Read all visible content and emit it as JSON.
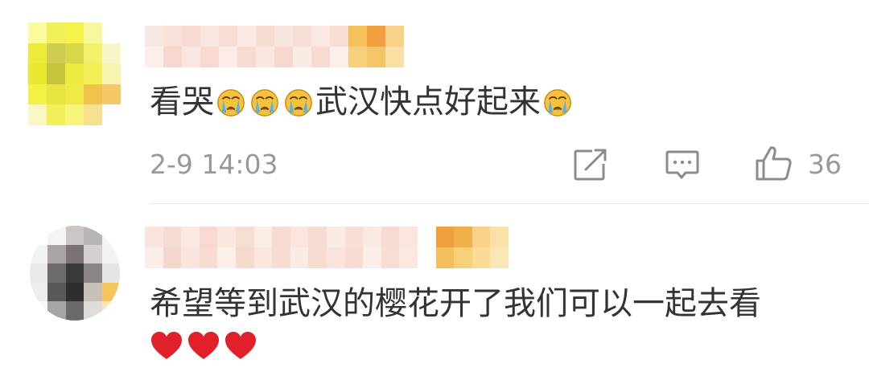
{
  "comments": [
    {
      "text_parts": [
        "看哭",
        "武汉快点好起来"
      ],
      "emoji": "crying-face-icon",
      "timestamp": "2-9 14:03",
      "like_count": "36"
    },
    {
      "text": "希望等到武汉的樱花开了我们可以一起去看",
      "reaction": "heart-icon"
    }
  ],
  "colors": {
    "text": "#333333",
    "meta": "#999999",
    "heart": "#e0202a",
    "emoji_face": "#f5c33b"
  }
}
